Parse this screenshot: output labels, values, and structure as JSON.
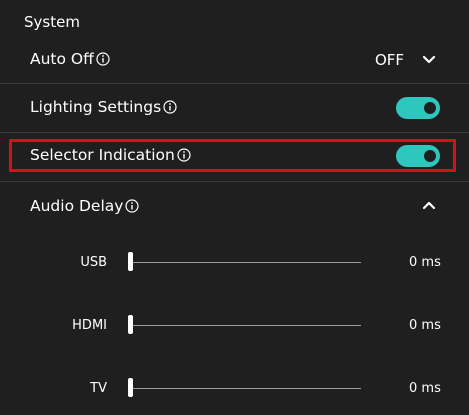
{
  "section": {
    "title": "System"
  },
  "auto_off": {
    "label": "Auto Off",
    "value": "OFF",
    "info_icon": "info-icon",
    "chevron_icon": "chevron-down-icon"
  },
  "lighting": {
    "label": "Lighting Settings",
    "on": true
  },
  "selector": {
    "label": "Selector Indication",
    "on": true,
    "highlighted": true
  },
  "audio_delay": {
    "label": "Audio Delay",
    "expanded": true,
    "chevron_icon": "chevron-up-icon",
    "channels": [
      {
        "label": "USB",
        "value": "0 ms",
        "level": 0
      },
      {
        "label": "HDMI",
        "value": "0 ms",
        "level": 0
      },
      {
        "label": "TV",
        "value": "0 ms",
        "level": 0
      }
    ]
  },
  "colors": {
    "accent": "#2ec7bd",
    "highlight": "#d4101c",
    "background": "#1f1f1f"
  }
}
